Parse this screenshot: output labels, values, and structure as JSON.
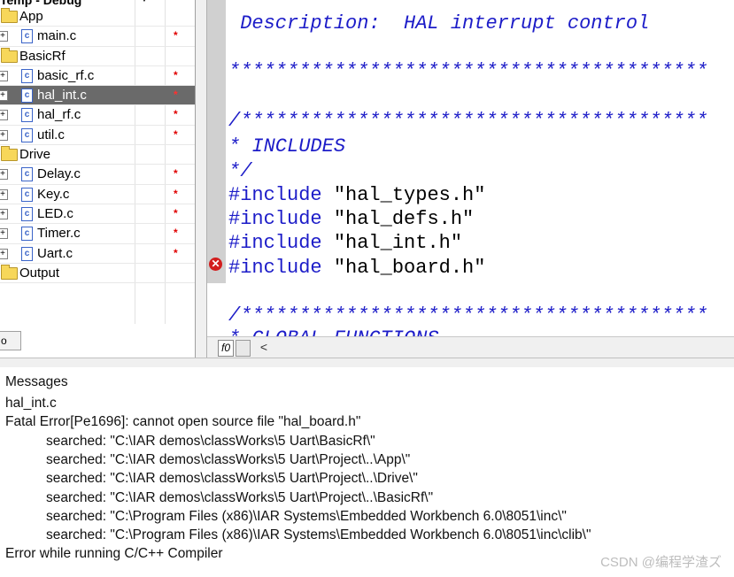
{
  "workspace": {
    "config_name": "Temp - Debug",
    "tab_label": "o",
    "rows": [
      {
        "kind": "folder",
        "label": "App",
        "expanded": false,
        "mark": "",
        "selected": false
      },
      {
        "kind": "file",
        "label": "main.c",
        "mark": "*",
        "selected": false
      },
      {
        "kind": "folder",
        "label": "BasicRf",
        "mark": "",
        "selected": false
      },
      {
        "kind": "file",
        "label": "basic_rf.c",
        "mark": "*",
        "selected": false
      },
      {
        "kind": "file",
        "label": "hal_int.c",
        "mark": "*",
        "selected": true
      },
      {
        "kind": "file",
        "label": "hal_rf.c",
        "mark": "*",
        "selected": false
      },
      {
        "kind": "file",
        "label": "util.c",
        "mark": "*",
        "selected": false
      },
      {
        "kind": "folder",
        "label": "Drive",
        "mark": "",
        "selected": false
      },
      {
        "kind": "file",
        "label": "Delay.c",
        "mark": "*",
        "selected": false
      },
      {
        "kind": "file",
        "label": "Key.c",
        "mark": "*",
        "selected": false
      },
      {
        "kind": "file",
        "label": "LED.c",
        "mark": "*",
        "selected": false
      },
      {
        "kind": "file",
        "label": "Timer.c",
        "mark": "*",
        "selected": false
      },
      {
        "kind": "file",
        "label": "Uart.c",
        "mark": "*",
        "selected": false
      },
      {
        "kind": "folder",
        "label": "Output",
        "mark": "",
        "selected": false
      }
    ]
  },
  "editor": {
    "lines": [
      {
        "text": " Description:  HAL interrupt control",
        "style": "comment"
      },
      {
        "text": "*****************************************",
        "style": "comment"
      },
      {
        "text": "/****************************************",
        "style": "comment"
      },
      {
        "text": "* INCLUDES",
        "style": "comment"
      },
      {
        "text": "*/",
        "style": "comment"
      },
      {
        "kw": "#include",
        "str": " \"hal_types.h\""
      },
      {
        "kw": "#include",
        "str": " \"hal_defs.h\""
      },
      {
        "kw": "#include",
        "str": " \"hal_int.h\""
      },
      {
        "kw": "#include",
        "str": " \"hal_board.h\""
      },
      {
        "text": "/****************************************",
        "style": "comment"
      },
      {
        "text": "* GLOBAL FUNCTIONS",
        "style": "comment"
      }
    ],
    "function_box": "f0",
    "scroll_left": "<"
  },
  "messages": {
    "header": "Messages",
    "lines": [
      {
        "text": "hal_int.c",
        "indent": false
      },
      {
        "text": "Fatal Error[Pe1696]: cannot open source file \"hal_board.h\"",
        "indent": false
      },
      {
        "text": "searched: \"C:\\IAR demos\\classWorks\\5 Uart\\BasicRf\\\"",
        "indent": true
      },
      {
        "text": "searched: \"C:\\IAR demos\\classWorks\\5 Uart\\Project\\..\\App\\\"",
        "indent": true
      },
      {
        "text": "searched: \"C:\\IAR demos\\classWorks\\5 Uart\\Project\\..\\Drive\\\"",
        "indent": true
      },
      {
        "text": "searched: \"C:\\IAR demos\\classWorks\\5 Uart\\Project\\..\\BasicRf\\\"",
        "indent": true
      },
      {
        "text": "searched: \"C:\\Program Files (x86)\\IAR Systems\\Embedded Workbench 6.0\\8051\\inc\\\"",
        "indent": true
      },
      {
        "text": "searched: \"C:\\Program Files (x86)\\IAR Systems\\Embedded Workbench 6.0\\8051\\inc\\clib\\\"",
        "indent": true
      },
      {
        "text": "Error while running C/C++ Compiler",
        "indent": false
      }
    ]
  },
  "watermark": "CSDN @编程学渣ズ",
  "colors": {
    "comment": "#1c1cc8",
    "error": "#d21e1e",
    "selection": "#6a6a6a",
    "marker": "#e00000"
  }
}
